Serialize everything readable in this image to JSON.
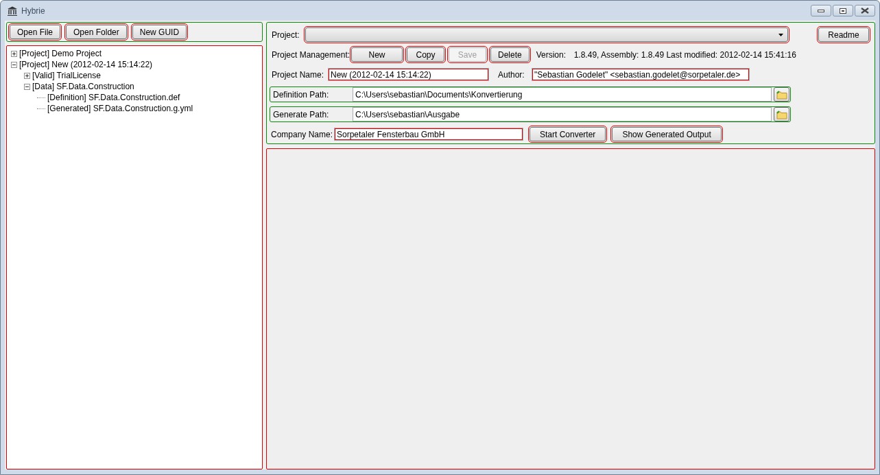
{
  "window": {
    "title": "Hybrie"
  },
  "toolbar": [
    "Open File",
    "Open Folder",
    "New GUID"
  ],
  "tree": [
    {
      "label": "[Project] Demo Project",
      "kind": "folder",
      "expanded": false
    },
    {
      "label": "[Project] New (2012-02-14 15:14:22)",
      "kind": "folder",
      "expanded": true,
      "children": [
        {
          "label": "[Valid] TrialLicense",
          "kind": "folder",
          "expanded": false
        },
        {
          "label": "[Data] SF.Data.Construction",
          "kind": "folder",
          "expanded": true,
          "children": [
            {
              "label": "[Definition] SF.Data.Construction.def",
              "kind": "leaf"
            },
            {
              "label": "[Generated] SF.Data.Construction.g.yml",
              "kind": "leaf"
            }
          ]
        }
      ]
    }
  ],
  "project": {
    "label": "Project:"
  },
  "readme_button": "Readme",
  "management": {
    "label": "Project Management:",
    "buttons": [
      {
        "label": "New",
        "disabled": false
      },
      {
        "label": "Copy",
        "disabled": false
      },
      {
        "label": "Save",
        "disabled": true
      },
      {
        "label": "Delete",
        "disabled": false
      }
    ],
    "version_label": "Version:",
    "version": "1.8.49, Assembly: 1.8.49 Last modified: 2012-02-14 15:41:16"
  },
  "project_name": {
    "label": "Project Name:",
    "value": "New (2012-02-14 15:14:22)"
  },
  "author": {
    "label": "Author:",
    "value": "\"Sebastian Godelet\" <sebastian.godelet@sorpetaler.de>"
  },
  "paths": [
    {
      "label": "Definition Path:",
      "value": "C:\\Users\\sebastian\\Documents\\Konvertierung"
    },
    {
      "label": "Generate Path:",
      "value": "C:\\Users\\sebastian\\Ausgabe"
    }
  ],
  "company": {
    "label": "Company Name:",
    "value": "Sorpetaler Fensterbau GmbH"
  },
  "actions": [
    "Start Converter",
    "Show Generated Output"
  ]
}
